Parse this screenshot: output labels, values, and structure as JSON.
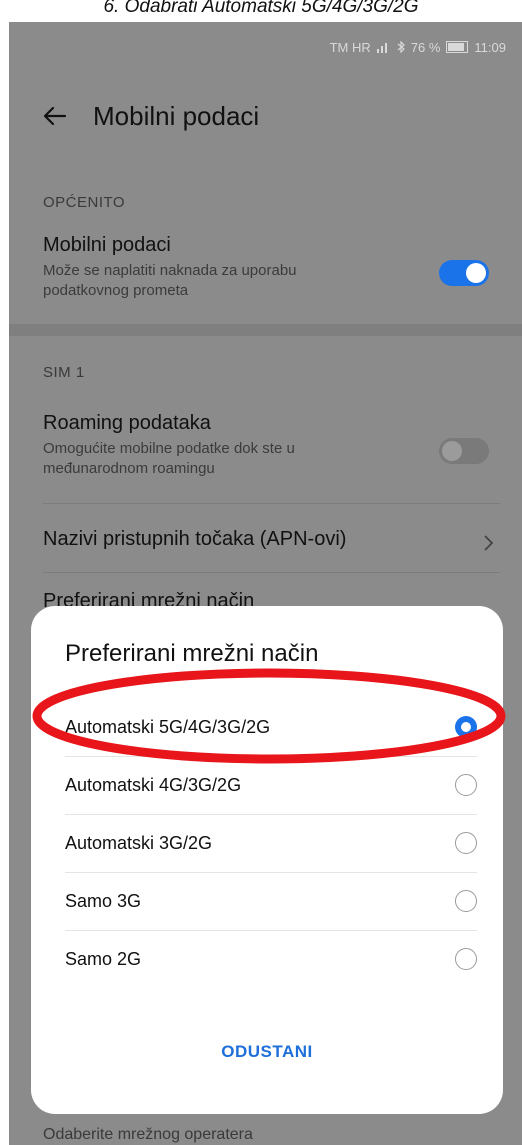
{
  "caption": "6.    Odabrati Automatski 5G/4G/3G/2G",
  "status_bar": {
    "carrier": "TM HR",
    "battery": "76 %",
    "battery_level": 0.76,
    "time": "11:09"
  },
  "app_bar": {
    "title": "Mobilni podaci",
    "back_icon": "arrow-left-icon"
  },
  "general": {
    "section": "OPĆENITO",
    "mobile_data": {
      "title": "Mobilni podaci",
      "subtitle": "Može se naplatiti naknada za uporabu podatkovnog prometa",
      "enabled": true
    }
  },
  "sim1": {
    "section": "SIM 1",
    "roaming": {
      "title": "Roaming podataka",
      "subtitle": "Omogućite mobilne podatke dok ste u međunarodnom roamingu",
      "enabled": false
    },
    "apn": {
      "title": "Nazivi pristupnih točaka (APN-ovi)"
    },
    "preferred_network": {
      "title": "Preferirani mrežni način"
    }
  },
  "bottom_hint": "Odaberite mrežnog operatera",
  "dialog": {
    "title": "Preferirani mrežni način",
    "options": [
      {
        "label": "Automatski 5G/4G/3G/2G",
        "selected": true
      },
      {
        "label": "Automatski 4G/3G/2G",
        "selected": false
      },
      {
        "label": "Automatski 3G/2G",
        "selected": false
      },
      {
        "label": "Samo 3G",
        "selected": false
      },
      {
        "label": "Samo 2G",
        "selected": false
      }
    ],
    "cancel": "ODUSTANI"
  },
  "colors": {
    "accent": "#1a73e8",
    "annotation": "#e8151b",
    "scrim": "#8b8b8b"
  }
}
